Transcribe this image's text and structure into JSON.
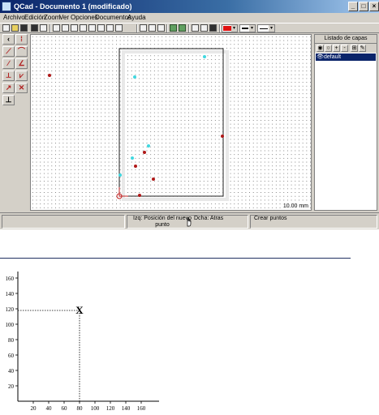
{
  "window": {
    "title": "QCad - Documento 1 (modificado)",
    "buttons": [
      "_",
      "□",
      "×"
    ]
  },
  "menu": [
    "Archivo",
    "Edición",
    "Zoom",
    "Ver",
    "Opciones",
    "Documentos",
    "Ayuda"
  ],
  "canvas": {
    "scale_label": "10.00 mm"
  },
  "layers": {
    "header": "Listado de capas",
    "buttons": [
      "◉",
      "○",
      "+",
      "-",
      "⊞",
      "✎"
    ],
    "items": [
      "default"
    ]
  },
  "status": {
    "left_label": "Izq: Posición del nuevo punto",
    "right_label": "Dcha: Atras",
    "command": "Crear puntos"
  },
  "plot": {
    "y_ticks": [
      "160",
      "140",
      "120",
      "100",
      "80",
      "60",
      "40",
      "20"
    ],
    "x_ticks": [
      "20",
      "40",
      "60",
      "80",
      "100",
      "120",
      "140",
      "160"
    ],
    "marker": "X"
  },
  "colors": {
    "title_start": "#0a246a",
    "cyan_point": "#40d8e0",
    "red_point": "#b01818"
  }
}
